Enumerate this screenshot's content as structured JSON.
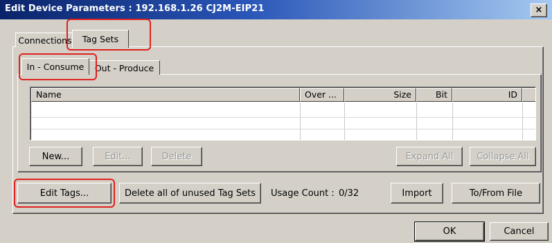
{
  "window": {
    "title": "Edit Device Parameters : 192.168.1.26 CJ2M-EIP21",
    "close_glyph": "×"
  },
  "outer_tabs": [
    {
      "label": "Connections"
    },
    {
      "label": "Tag Sets"
    }
  ],
  "inner_tabs": [
    {
      "label": "In - Consume"
    },
    {
      "label": "Out - Produce"
    }
  ],
  "table": {
    "columns": [
      "Name",
      "Over ...",
      "Size",
      "Bit",
      "ID"
    ],
    "rows": []
  },
  "row_buttons": {
    "new": "New...",
    "edit": "Edit...",
    "delete": "Delete",
    "expand_all": "Expand All",
    "collapse_all": "Collapse All"
  },
  "actions": {
    "edit_tags": "Edit Tags...",
    "delete_unused": "Delete all of unused Tag Sets",
    "usage_count_label": "Usage Count :",
    "usage_count_value": "0/32",
    "import": "Import",
    "to_from_file": "To/From File"
  },
  "dialog_buttons": {
    "ok": "OK",
    "cancel": "Cancel"
  },
  "colors": {
    "title_gradient_start": "#0a246a",
    "title_gradient_end": "#a6caf0",
    "highlight": "#e0201b",
    "face": "#d4d0c8"
  }
}
